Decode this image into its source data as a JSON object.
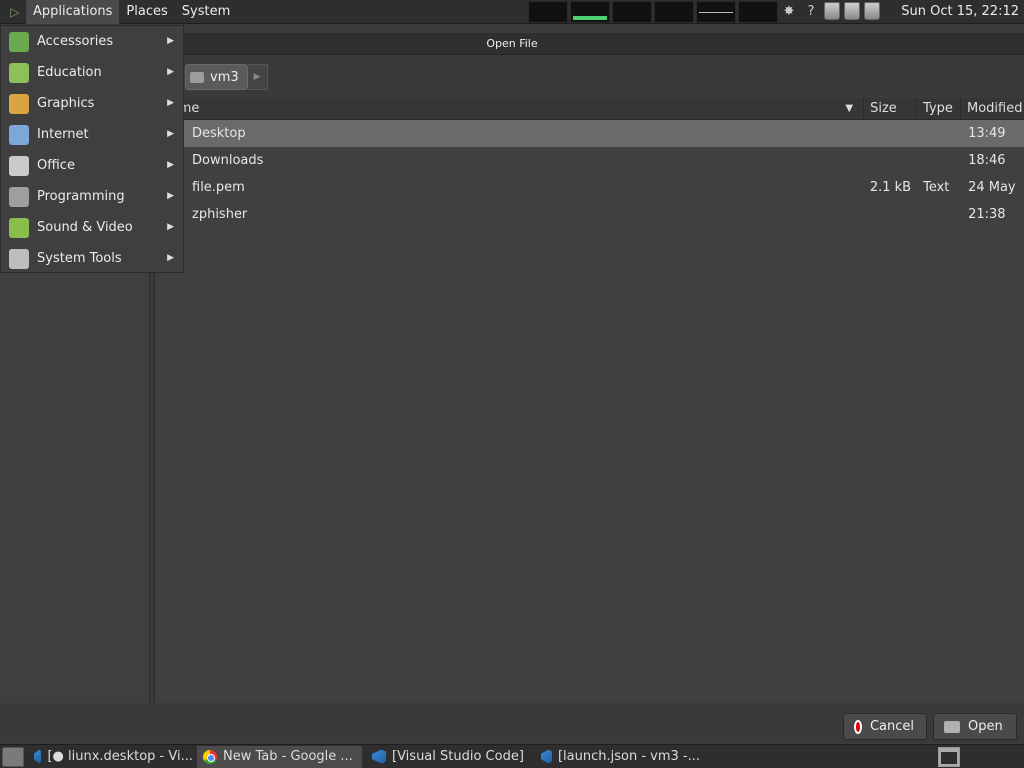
{
  "top_panel": {
    "menus": [
      "Applications",
      "Places",
      "System"
    ],
    "tray_help": "?",
    "clock": "Sun Oct 15, 22:12"
  },
  "applications_menu": {
    "items": [
      {
        "label": "Accessories",
        "icon": "accessories-icon",
        "color": "#6aa84f"
      },
      {
        "label": "Education",
        "icon": "education-icon",
        "color": "#8fbf5a"
      },
      {
        "label": "Graphics",
        "icon": "graphics-icon",
        "color": "#d9a441"
      },
      {
        "label": "Internet",
        "icon": "internet-icon",
        "color": "#7da7d9"
      },
      {
        "label": "Office",
        "icon": "office-icon",
        "color": "#c9c9c9"
      },
      {
        "label": "Programming",
        "icon": "programming-icon",
        "color": "#9e9e9e"
      },
      {
        "label": "Sound & Video",
        "icon": "sound-video-icon",
        "color": "#8bbd4a"
      },
      {
        "label": "System Tools",
        "icon": "system-tools-icon",
        "color": "#bdbdbd"
      }
    ]
  },
  "dialog": {
    "title": "Open File",
    "path_button": "vm3",
    "columns": {
      "name": "Name",
      "size": "Size",
      "type": "Type",
      "modified": "Modified"
    },
    "files": [
      {
        "name": "Desktop",
        "size": "",
        "type": "",
        "modified": "13:49",
        "selected": true
      },
      {
        "name": "Downloads",
        "size": "",
        "type": "",
        "modified": "18:46",
        "selected": false
      },
      {
        "name": "file.pem",
        "size": "2.1 kB",
        "type": "Text",
        "modified": "24 May",
        "selected": false
      },
      {
        "name": "zphisher",
        "size": "",
        "type": "",
        "modified": "21:38",
        "selected": false
      }
    ],
    "cancel_label": "Cancel",
    "open_label": "Open"
  },
  "taskbar": {
    "tasks": [
      {
        "label": "[● liunx.desktop - Vi...",
        "icon": "vscode-icon",
        "active": false
      },
      {
        "label": "New Tab - Google ...",
        "icon": "chrome-icon",
        "active": true
      },
      {
        "label": "[Visual Studio Code]",
        "icon": "vscode-icon",
        "active": false
      },
      {
        "label": "[launch.json - vm3 -...",
        "icon": "vscode-icon",
        "active": false
      }
    ]
  }
}
